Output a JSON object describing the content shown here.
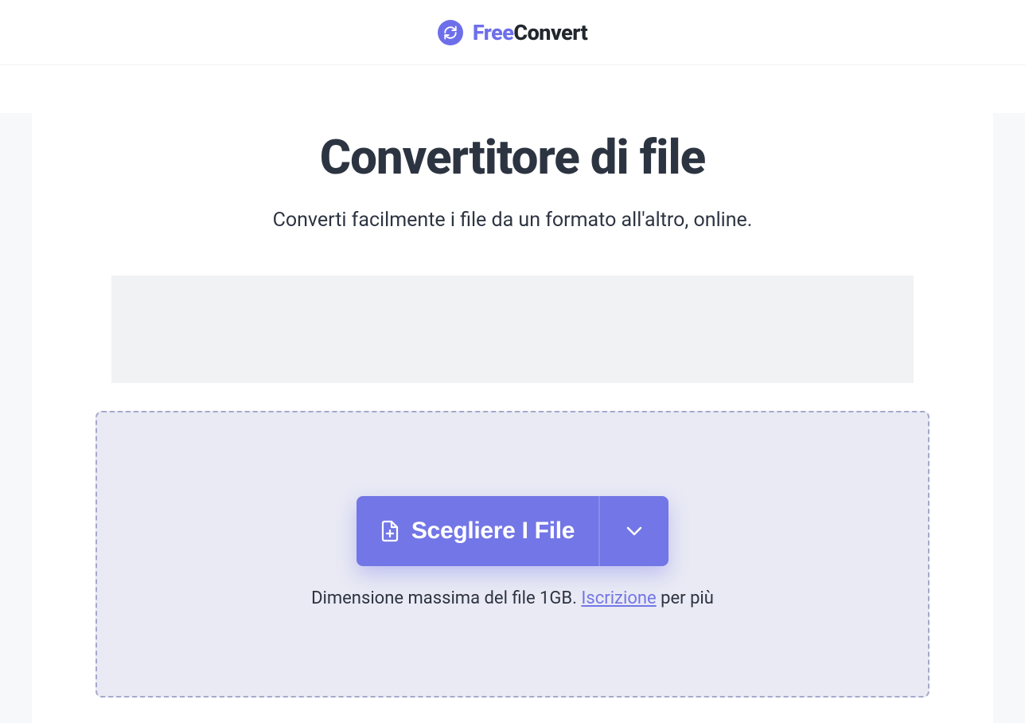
{
  "header": {
    "logo_free": "Free",
    "logo_convert": "Convert"
  },
  "main": {
    "title": "Convertitore di file",
    "subtitle": "Converti facilmente i file da un formato all'altro, online."
  },
  "dropzone": {
    "choose_files_label": "Scegliere I File",
    "max_size_prefix": "Dimensione massima del file 1GB. ",
    "signup_link": "Iscrizione",
    "max_size_suffix": " per più"
  }
}
